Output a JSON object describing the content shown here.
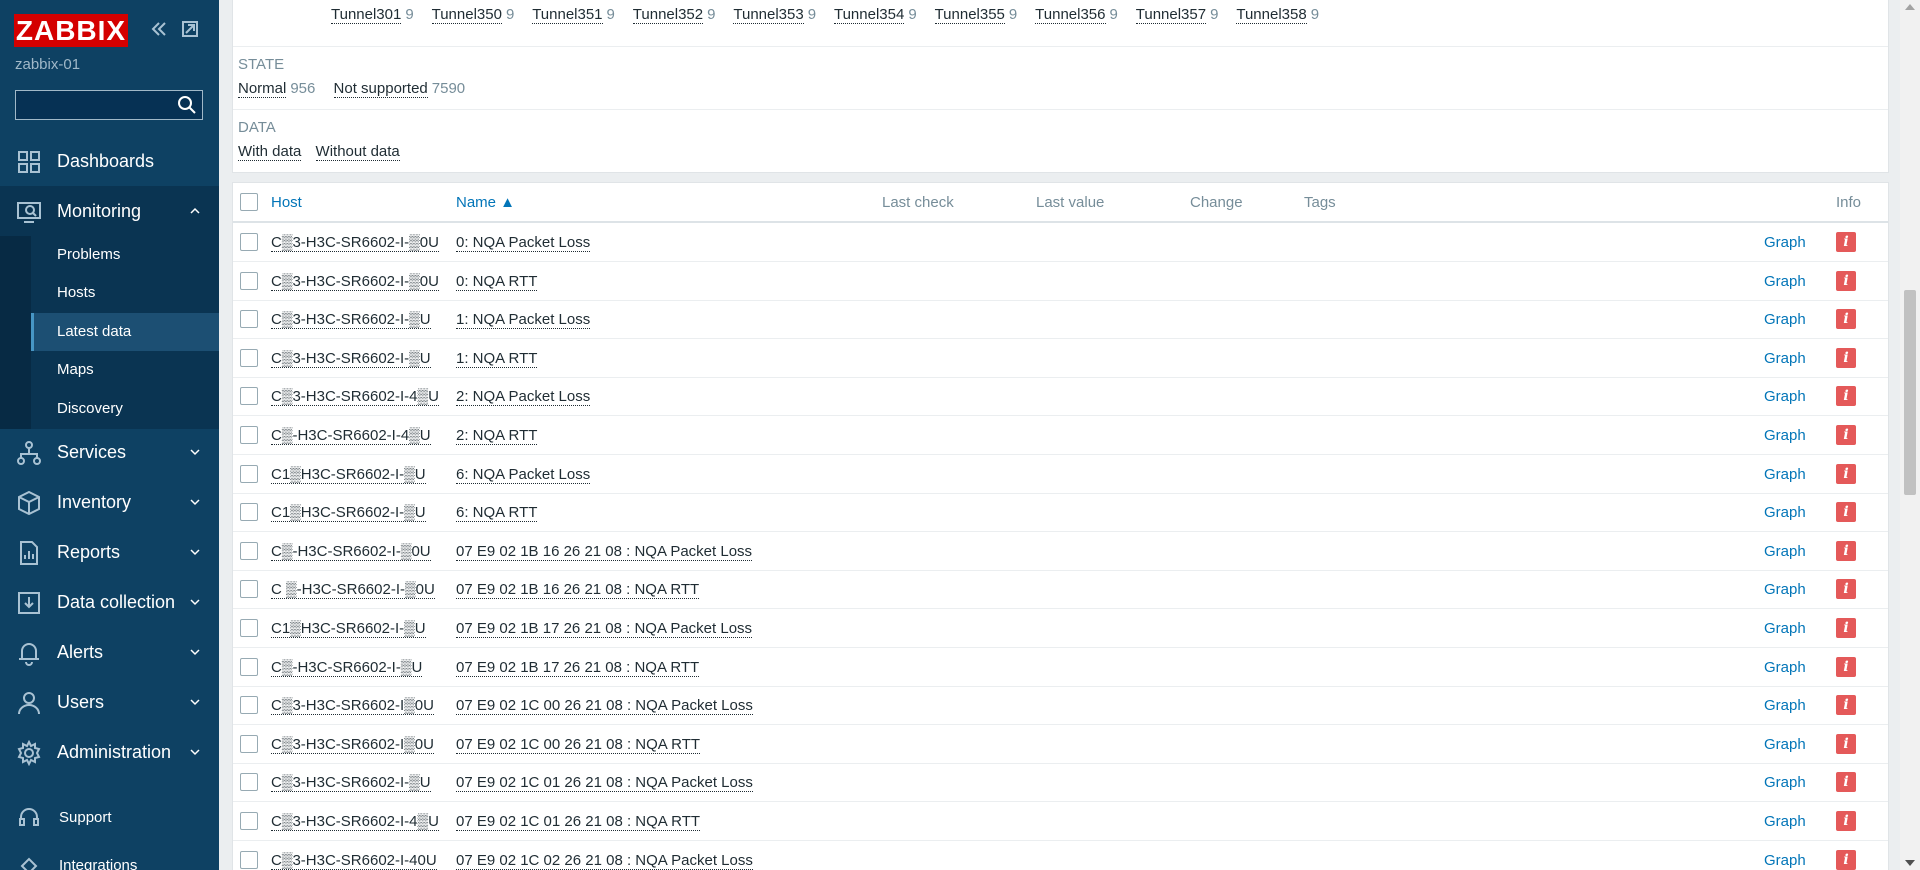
{
  "brand": {
    "logo": "ZABBIX",
    "server": "zabbix-01"
  },
  "search": {
    "placeholder": ""
  },
  "menu": [
    {
      "label": "Dashboards",
      "icon": "dashboards-icon"
    },
    {
      "label": "Monitoring",
      "icon": "monitoring-icon"
    },
    {
      "label": "Services",
      "icon": "services-icon"
    },
    {
      "label": "Inventory",
      "icon": "inventory-icon"
    },
    {
      "label": "Reports",
      "icon": "reports-icon"
    },
    {
      "label": "Data collection",
      "icon": "data-collection-icon"
    },
    {
      "label": "Alerts",
      "icon": "alerts-icon"
    },
    {
      "label": "Users",
      "icon": "users-icon"
    },
    {
      "label": "Administration",
      "icon": "administration-icon"
    }
  ],
  "submenu": [
    "Problems",
    "Hosts",
    "Latest data",
    "Maps",
    "Discovery"
  ],
  "bottom_menu": [
    "Support",
    "Integrations"
  ],
  "filter": {
    "tunnels": [
      {
        "name": "Tunnel301",
        "count": "9"
      },
      {
        "name": "Tunnel350",
        "count": "9"
      },
      {
        "name": "Tunnel351",
        "count": "9"
      },
      {
        "name": "Tunnel352",
        "count": "9"
      },
      {
        "name": "Tunnel353",
        "count": "9"
      },
      {
        "name": "Tunnel354",
        "count": "9"
      },
      {
        "name": "Tunnel355",
        "count": "9"
      },
      {
        "name": "Tunnel356",
        "count": "9"
      },
      {
        "name": "Tunnel357",
        "count": "9"
      },
      {
        "name": "Tunnel358",
        "count": "9"
      }
    ],
    "state_label": "STATE",
    "state": [
      {
        "name": "Normal",
        "count": "956"
      },
      {
        "name": "Not supported",
        "count": "7590"
      }
    ],
    "data_label": "DATA",
    "data": [
      "With data",
      "Without data"
    ]
  },
  "table": {
    "headers": {
      "host": "Host",
      "name": "Name ▲",
      "last_check": "Last check",
      "last_value": "Last value",
      "change": "Change",
      "tags": "Tags",
      "info": "Info"
    },
    "rows": [
      {
        "host": "C▒3-H3C-SR6602-I-▒0U",
        "name": "0: NQA Packet Loss"
      },
      {
        "host": "C▒3-H3C-SR6602-I-▒0U",
        "name": "0: NQA RTT"
      },
      {
        "host": "C▒3-H3C-SR6602-I-▒U",
        "name": "1: NQA Packet Loss"
      },
      {
        "host": "C▒3-H3C-SR6602-I-▒U",
        "name": "1: NQA RTT"
      },
      {
        "host": "C▒3-H3C-SR6602-I-4▒U",
        "name": "2: NQA Packet Loss"
      },
      {
        "host": "C▒-H3C-SR6602-I-4▒U",
        "name": "2: NQA RTT"
      },
      {
        "host": "C1▒H3C-SR6602-I-▒U",
        "name": "6: NQA Packet Loss"
      },
      {
        "host": "C1▒H3C-SR6602-I-▒U",
        "name": "6: NQA RTT"
      },
      {
        "host": "C▒-H3C-SR6602-I-▒0U",
        "name": "07 E9 02 1B 16 26 21 08 : NQA Packet Loss"
      },
      {
        "host": "C ▒-H3C-SR6602-I-▒0U",
        "name": "07 E9 02 1B 16 26 21 08 : NQA RTT"
      },
      {
        "host": "C1▒H3C-SR6602-I-▒U",
        "name": "07 E9 02 1B 17 26 21 08 : NQA Packet Loss"
      },
      {
        "host": "C▒-H3C-SR6602-I-▒U",
        "name": "07 E9 02 1B 17 26 21 08 : NQA RTT"
      },
      {
        "host": "C▒3-H3C-SR6602-I▒0U",
        "name": "07 E9 02 1C 00 26 21 08 : NQA Packet Loss"
      },
      {
        "host": "C▒3-H3C-SR6602-I▒0U",
        "name": "07 E9 02 1C 00 26 21 08 : NQA RTT"
      },
      {
        "host": "C▒3-H3C-SR6602-I-▒U",
        "name": "07 E9 02 1C 01 26 21 08 : NQA Packet Loss"
      },
      {
        "host": "C▒3-H3C-SR6602-I-4▒U",
        "name": "07 E9 02 1C 01 26 21 08 : NQA RTT"
      },
      {
        "host": "C▒3-H3C-SR6602-I-40U",
        "name": "07 E9 02 1C 02 26 21 08 : NQA Packet Loss"
      }
    ],
    "graph_label": "Graph",
    "info_glyph": "i"
  },
  "colors": {
    "sidebar": "#0e4163",
    "link": "#0275b8",
    "logo": "#d40000",
    "info": "#e45959"
  }
}
